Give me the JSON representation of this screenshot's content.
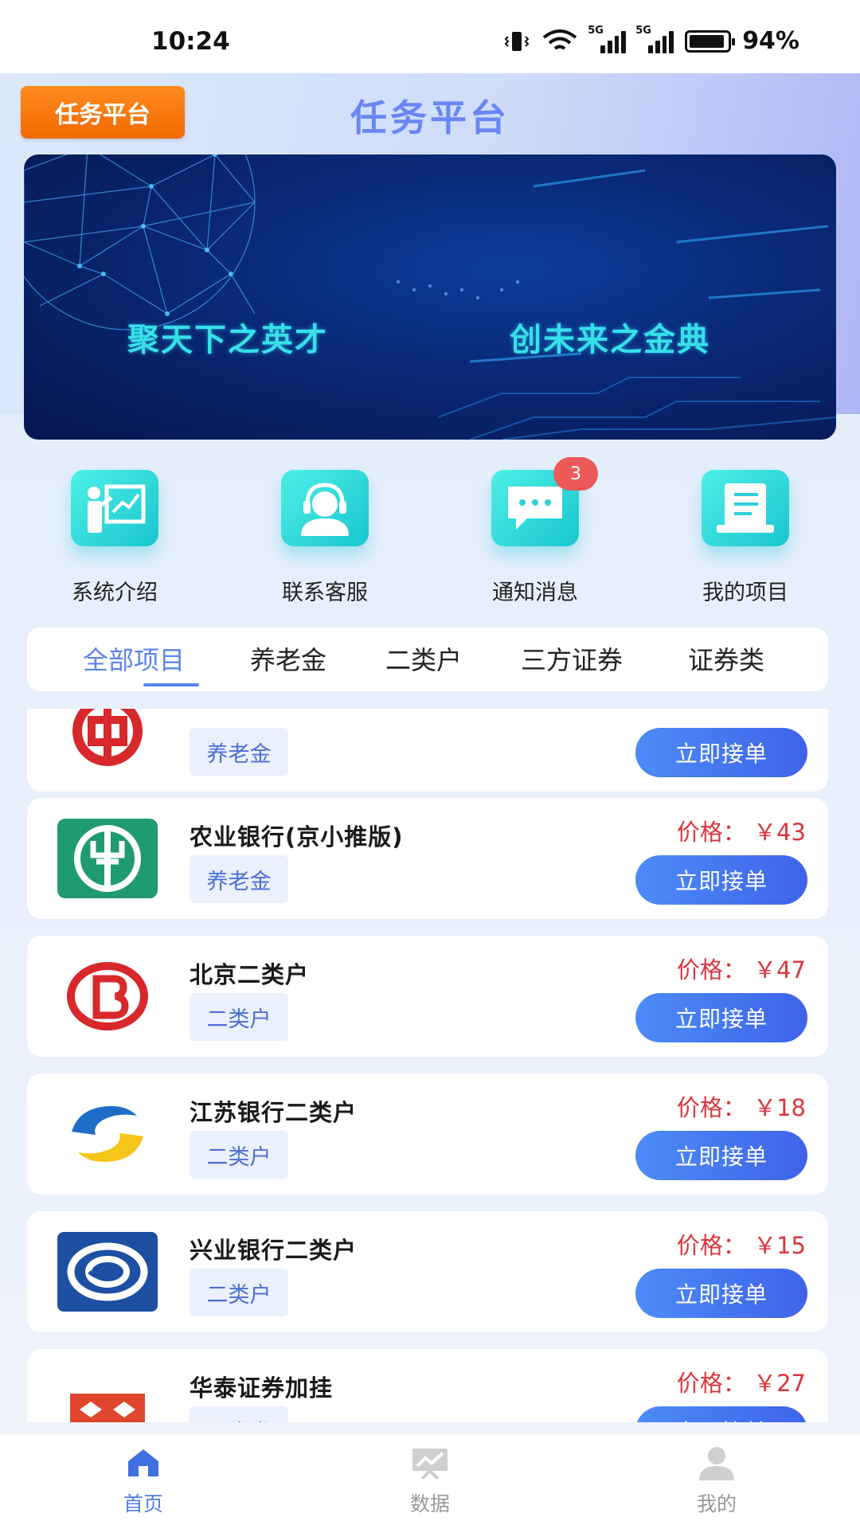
{
  "status_bar": {
    "time": "10:24",
    "battery": "94%",
    "signal_1": "5G",
    "signal_2": "5G"
  },
  "header": {
    "badge": "任务平台",
    "title": "任务平台"
  },
  "banner": {
    "text_left": "聚天下之英才",
    "text_right": "创未来之金典"
  },
  "shortcuts": [
    {
      "label": "系统介绍",
      "icon": "presentation-icon"
    },
    {
      "label": "联系客服",
      "icon": "headset-icon"
    },
    {
      "label": "通知消息",
      "icon": "chat-icon",
      "badge": "3"
    },
    {
      "label": "我的项目",
      "icon": "document-icon"
    }
  ],
  "tabs": [
    "全部项目",
    "养老金",
    "二类户",
    "三方证券",
    "证券类"
  ],
  "active_tab": "全部项目",
  "items": [
    {
      "name": "",
      "tag": "养老金",
      "price": "",
      "button": "立即接单",
      "logo": "bank-of-china-logo"
    },
    {
      "name": "农业银行(京小推版)",
      "tag": "养老金",
      "price": "价格： ￥43",
      "button": "立即接单",
      "logo": "agricultural-bank-logo"
    },
    {
      "name": "北京二类户",
      "tag": "二类户",
      "price": "价格： ￥47",
      "button": "立即接单",
      "logo": "bank-of-beijing-logo"
    },
    {
      "name": "江苏银行二类户",
      "tag": "二类户",
      "price": "价格： ￥18",
      "button": "立即接单",
      "logo": "bank-of-jiangsu-logo"
    },
    {
      "name": "兴业银行二类户",
      "tag": "二类户",
      "price": "价格： ￥15",
      "button": "立即接单",
      "logo": "industrial-bank-logo"
    },
    {
      "name": "华泰证券加挂",
      "tag": "证券类",
      "price": "价格： ￥27",
      "button": "立即接单",
      "logo": "huatai-securities-logo"
    }
  ],
  "bottom_nav": [
    {
      "label": "首页",
      "icon": "home-icon",
      "active": true
    },
    {
      "label": "数据",
      "icon": "chart-icon",
      "active": false
    },
    {
      "label": "我的",
      "icon": "user-icon",
      "active": false
    }
  ],
  "colors": {
    "accent": "#4d7ce6",
    "price": "#d9363e",
    "badge_orange": "#f57c00",
    "teal": "#1fc9d3"
  }
}
